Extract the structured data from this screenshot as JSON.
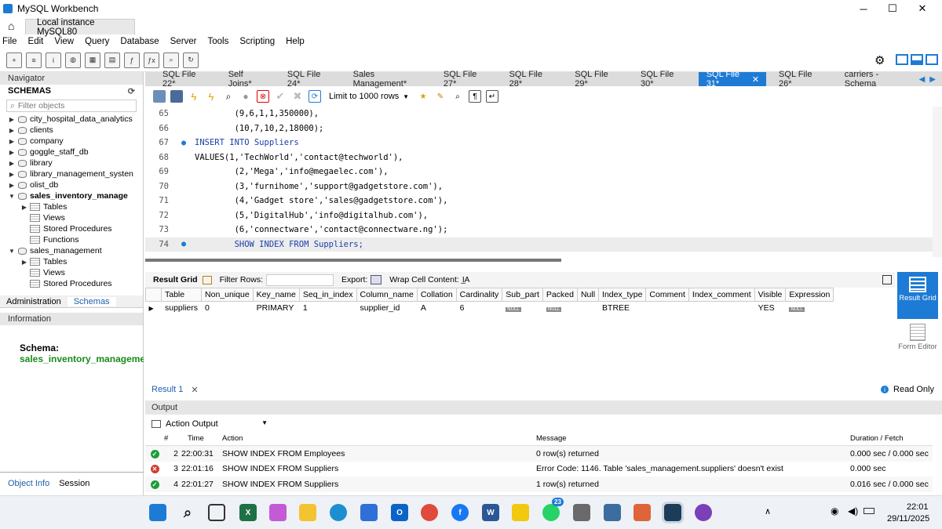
{
  "window": {
    "title": "MySQL Workbench",
    "connection_tab": "Local instance MySQL80",
    "minimize": "─",
    "maximize": "☐",
    "close": "✕"
  },
  "menu": [
    "File",
    "Edit",
    "View",
    "Query",
    "Database",
    "Server",
    "Tools",
    "Scripting",
    "Help"
  ],
  "navigator": {
    "header": "Navigator",
    "schemas_label": "SCHEMAS",
    "filter_placeholder": "Filter objects",
    "schemas": [
      "city_hospital_data_analytics",
      "clients",
      "company",
      "goggle_staff_db",
      "library",
      "library_management_systen",
      "olist_db",
      "sales_inventory_manage",
      "Tables",
      "Views",
      "Stored Procedures",
      "Functions",
      "sales_management",
      "Tables",
      "Views",
      "Stored Procedures"
    ],
    "tabs": [
      "Administration",
      "Schemas"
    ],
    "info_header": "Information",
    "info_schema_label": "Schema:",
    "info_schema_value": "sales_inventory_managemen",
    "bottom_tabs": [
      "Object Info",
      "Session"
    ]
  },
  "editor_tabs": [
    "SQL File 22*",
    "Self Joins*",
    "SQL File 24*",
    "Sales Management*",
    "SQL File 27*",
    "SQL File 28*",
    "SQL File 29*",
    "SQL File 30*",
    "SQL File 31*",
    "SQL File 26*",
    "carriers - Schema"
  ],
  "active_tab_index": 8,
  "limit_rows": "Limit to 1000 rows",
  "code_lines": [
    {
      "n": "65",
      "t": "        (9,6,1,1,350000),"
    },
    {
      "n": "66",
      "t": "        (10,7,10,2,18000);"
    },
    {
      "n": "67",
      "t": "INSERT INTO Suppliers"
    },
    {
      "n": "68",
      "t": "VALUES(1,'TechWorld','contact@techworld'),"
    },
    {
      "n": "69",
      "t": "        (2,'Mega','info@megaelec.com'),"
    },
    {
      "n": "70",
      "t": "        (3,'furnihome','support@gadgetstore.com'),"
    },
    {
      "n": "71",
      "t": "        (4,'Gadget store','sales@gadgetstore.com'),"
    },
    {
      "n": "72",
      "t": "        (5,'DigitalHub','info@digitalhub.com'),"
    },
    {
      "n": "73",
      "t": "        (6,'connectware','contact@connectware.ng');"
    },
    {
      "n": "74",
      "t": "        SHOW INDEX FROM Suppliers;"
    }
  ],
  "result_bar": {
    "result_grid": "Result Grid",
    "filter_rows": "Filter Rows:",
    "export": "Export:",
    "wrap": "Wrap Cell Content:"
  },
  "result_columns": [
    "Table",
    "Non_unique",
    "Key_name",
    "Seq_in_index",
    "Column_name",
    "Collation",
    "Cardinality",
    "Sub_part",
    "Packed",
    "Null",
    "Index_type",
    "Comment",
    "Index_comment",
    "Visible",
    "Expression"
  ],
  "result_rows": [
    [
      "suppliers",
      "0",
      "PRIMARY",
      "1",
      "supplier_id",
      "A",
      "6",
      "NULL",
      "NULL",
      "",
      "BTREE",
      "",
      "",
      "YES",
      "NULL"
    ]
  ],
  "side_buttons": {
    "result_grid": "Result Grid",
    "form_editor": "Form Editor"
  },
  "result_tab": "Result 1",
  "read_only": "Read Only",
  "output": {
    "header": "Output",
    "selector": "Action Output",
    "columns": [
      "#",
      "Time",
      "Action",
      "Message",
      "Duration / Fetch"
    ],
    "rows": [
      {
        "status": "ok",
        "num": "2",
        "time": "22:00:31",
        "action": "SHOW INDEX FROM Employees",
        "message": "0 row(s) returned",
        "duration": "0.000 sec / 0.000 sec"
      },
      {
        "status": "error",
        "num": "3",
        "time": "22:01:16",
        "action": "SHOW INDEX FROM Suppliers",
        "message": "Error Code: 1146. Table 'sales_management.suppliers' doesn't exist",
        "duration": "0.000 sec"
      },
      {
        "status": "ok",
        "num": "4",
        "time": "22:01:27",
        "action": "SHOW INDEX FROM Suppliers",
        "message": "1 row(s) returned",
        "duration": "0.016 sec / 0.000 sec"
      }
    ]
  },
  "taskbar": {
    "time": "22:01",
    "date": "29/11/2025",
    "whatsapp_badge": "23"
  },
  "colors": {
    "accent": "#1e7bd5",
    "ok": "#1f9d3a",
    "error": "#d23b2f"
  }
}
